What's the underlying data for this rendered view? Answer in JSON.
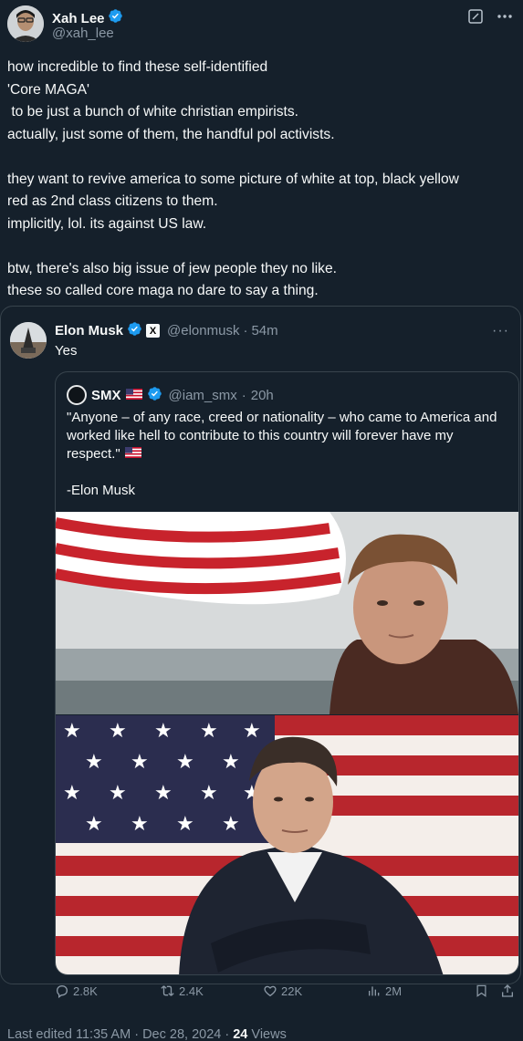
{
  "author": {
    "name": "Xah Lee",
    "handle": "@xah_lee"
  },
  "post": {
    "lines": [
      "how incredible to find these self-identified",
      "'Core MAGA'",
      " to be just a bunch of white christian empirists.",
      "actually, just some of them, the handful pol activists.",
      "",
      "they want to revive america to some picture of white at top, black yellow",
      "red as 2nd class citizens to them.",
      "implicitly, lol. its against US law.",
      "",
      "btw, there's also big issue of jew people they no like.",
      "these so called core maga no dare to say a thing."
    ]
  },
  "quoted": {
    "name": "Elon Musk",
    "badge": "X",
    "handle": "@elonmusk",
    "time": "54m",
    "more": "···",
    "text": "Yes",
    "inner": {
      "name": "SMX",
      "handle": "@iam_smx",
      "time": "20h",
      "text_line1": "\"Anyone – of any race, creed or nationality – who came to America and",
      "text_line2": "worked like hell to contribute to this country will forever have my",
      "text_line3": "respect.\"",
      "signature": "-Elon Musk"
    }
  },
  "actions": {
    "replies": "2.8K",
    "reposts": "2.4K",
    "likes": "22K",
    "views": "2M"
  },
  "meta": {
    "edited_prefix": "Last edited ",
    "time": "11:35 AM",
    "sep1": " · ",
    "date": "Dec 28, 2024",
    "sep2": " · ",
    "views_count": "24",
    "views_label": " Views"
  },
  "colors": {
    "background": "#15202b",
    "verified": "#1d9bf0",
    "muted": "#8b98a5",
    "border": "#38444d"
  }
}
